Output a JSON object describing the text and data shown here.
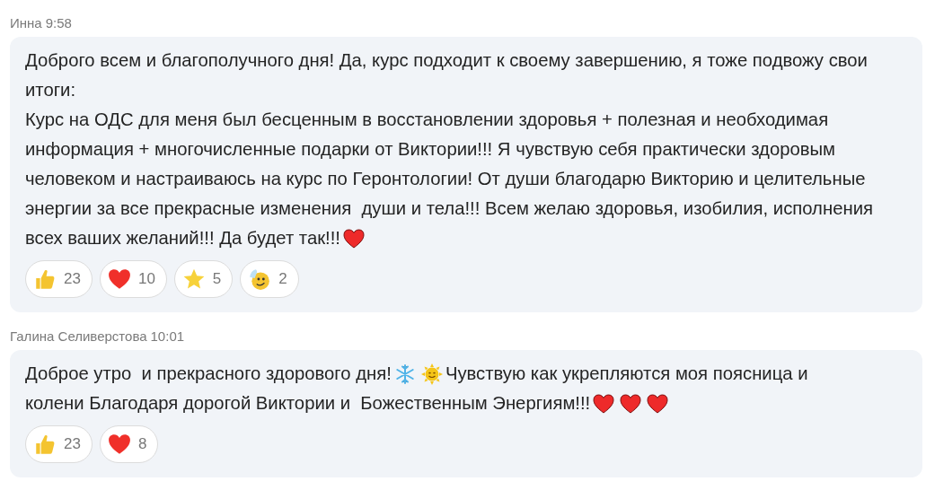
{
  "messages": [
    {
      "author": "Инна",
      "time": "9:58",
      "lines": [
        [
          {
            "kind": "text",
            "text": "Доброго всем и благополучного дня! Да, курс подходит к своему завершению, я тоже подвожу свои"
          }
        ],
        [
          {
            "kind": "text",
            "text": "итоги:"
          }
        ],
        [
          {
            "kind": "text",
            "text": "Курс на ОДС для меня был бесценным в восстановлении здоровья + полезная и необходимая"
          }
        ],
        [
          {
            "kind": "text",
            "text": "информация + многочисленные подарки от Виктории!!! Я чувствую себя практически здоровым"
          }
        ],
        [
          {
            "kind": "text",
            "text": "человеком и настраиваюсь на курс по Геронтологии! От души благодарю Викторию и целительные"
          }
        ],
        [
          {
            "kind": "text",
            "text": "энергии за все прекрасные изменения  души и тела!!! Всем желаю здоровья, изобилия, исполнения"
          }
        ],
        [
          {
            "kind": "text",
            "text": "всех ваших желаний!!! Да будет так!!!"
          },
          {
            "kind": "heart"
          }
        ]
      ],
      "reactions": [
        {
          "kind": "thumb",
          "count": "23"
        },
        {
          "kind": "heart",
          "count": "10"
        },
        {
          "kind": "star",
          "count": "5"
        },
        {
          "kind": "wave",
          "count": "2"
        }
      ]
    },
    {
      "author": "Галина Селиверстова",
      "time": "10:01",
      "lines": [
        [
          {
            "kind": "text",
            "text": "Доброе утро  и прекрасного здорового дня!"
          },
          {
            "kind": "snowflake"
          },
          {
            "kind": "sun"
          },
          {
            "kind": "text",
            "text": "Чувствую как укрепляются моя поясница и"
          }
        ],
        [
          {
            "kind": "text",
            "text": "колени Благодаря дорогой Виктории и  Божественным Энергиям!!!"
          },
          {
            "kind": "heart"
          },
          {
            "kind": "heart"
          },
          {
            "kind": "heart"
          }
        ]
      ],
      "reactions": [
        {
          "kind": "thumb",
          "count": "23"
        },
        {
          "kind": "heart",
          "count": "8"
        }
      ]
    }
  ]
}
